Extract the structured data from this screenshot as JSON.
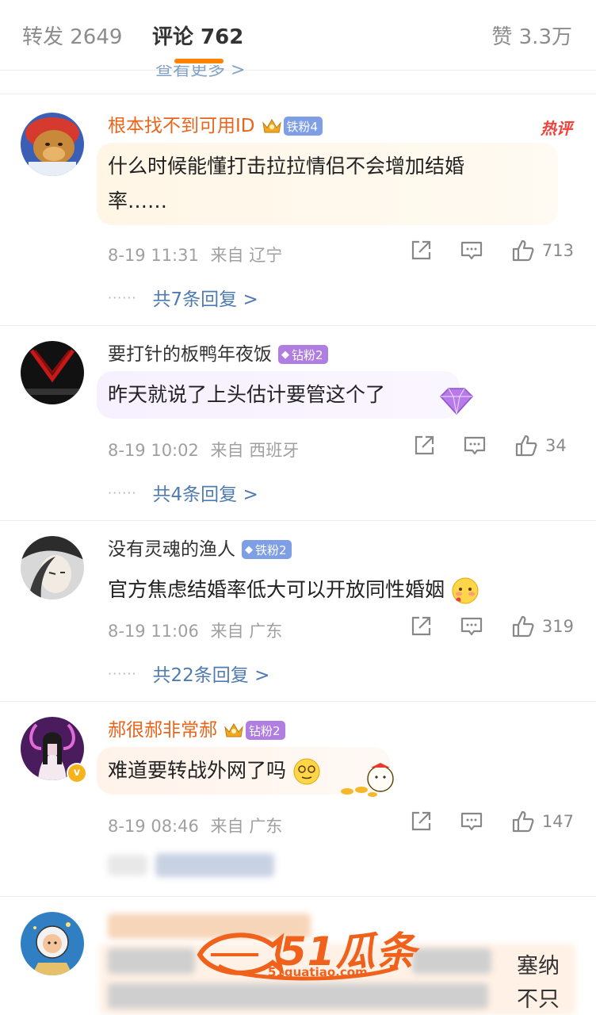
{
  "tabs": {
    "repost": "转发 2649",
    "comments": "评论 762",
    "likes": "赞 3.3万"
  },
  "partial_top_link": "查看更多 >",
  "comments": [
    {
      "username": "根本找不到可用ID",
      "badge": "铁粉4",
      "hot_tag": "热评",
      "text_line1": "什么时候能懂打击拉拉情侣不会增加结婚",
      "text_line2": "率……",
      "time": "8-19 11:31",
      "location": "来自 辽宁",
      "likes": "713",
      "replies": "共7条回复 >",
      "colors": {
        "name": "#e8651b"
      }
    },
    {
      "username": "要打针的板鸭年夜饭",
      "badge": "钻粉2",
      "text": "昨天就说了上头估计要管这个了",
      "time": "8-19 10:02",
      "location": "来自 西班牙",
      "likes": "34",
      "replies": "共4条回复 >"
    },
    {
      "username": "没有灵魂的渔人",
      "badge": "铁粉2",
      "text": "官方焦虑结婚率低大可以开放同性婚姻",
      "time": "8-19 11:06",
      "location": "来自 广东",
      "likes": "319",
      "replies": "共22条回复 >"
    },
    {
      "username": "郝很郝非常郝",
      "badge": "钻粉2",
      "text": "难道要转战外网了吗",
      "time": "8-19 08:46",
      "location": "来自 广东",
      "likes": "147"
    }
  ],
  "partial_bottom": {
    "line1_right": "塞纳",
    "line2_right": "不只"
  },
  "watermark": {
    "logo": "51瓜条",
    "url": "51guatiao.com"
  },
  "colors": {
    "accent": "#ff8200",
    "link": "#4f7bb0",
    "hot": "#f0413a"
  }
}
